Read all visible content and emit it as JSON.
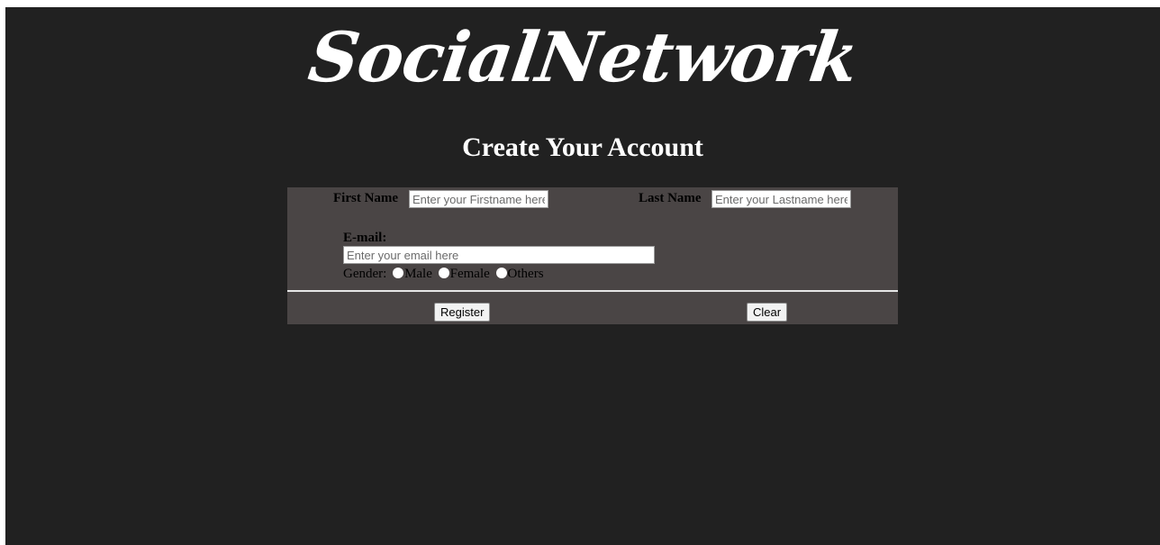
{
  "logo": {
    "text": "SocialNetwork"
  },
  "heading": "Create Your Account",
  "form": {
    "first_name": {
      "label": "First Name",
      "placeholder": "Enter your Firstname here"
    },
    "last_name": {
      "label": "Last Name",
      "placeholder": "Enter your Lastname here"
    },
    "email": {
      "label": "E-mail:",
      "placeholder": "Enter your email here"
    },
    "gender": {
      "label": "Gender:",
      "options": [
        "Male",
        "Female",
        "Others"
      ]
    },
    "register_label": "Register",
    "clear_label": "Clear"
  },
  "colors": {
    "background": "#212121",
    "panel": "#4a4545",
    "heading_text": "#ffffff"
  }
}
